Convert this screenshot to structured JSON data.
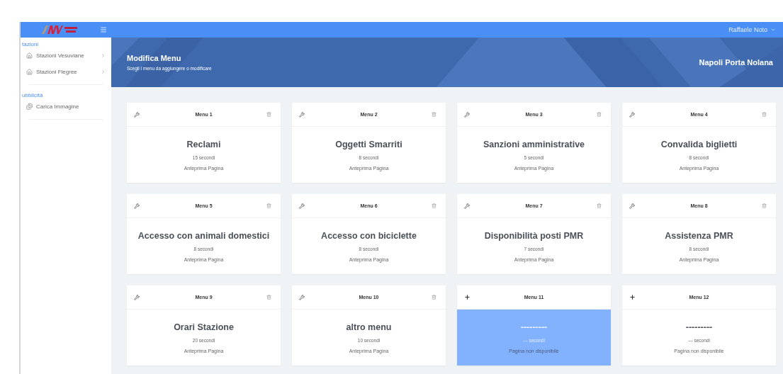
{
  "topbar": {
    "user": "Raffaele Noto"
  },
  "sidebar": {
    "sections": [
      {
        "title": "tazioni",
        "items": [
          {
            "label": "Stazioni Vesuviane",
            "expandable": true
          },
          {
            "label": "Stazioni Flegree",
            "expandable": true
          }
        ]
      },
      {
        "title": "ubblicità",
        "items": [
          {
            "label": "Carica Immagine",
            "expandable": false
          }
        ]
      }
    ]
  },
  "banner": {
    "title": "Modifica Menu",
    "subtitle": "Scegli i menu da aggiungere o modificare",
    "station": "Napoli Porta Nolana"
  },
  "cards": [
    {
      "kind": "configured",
      "header": "Menu 1",
      "title": "Reclami",
      "duration": "15 secondi",
      "link": "Anteprima Pagina",
      "selected": false
    },
    {
      "kind": "configured",
      "header": "Menu 2",
      "title": "Oggetti Smarriti",
      "duration": "8 secondi",
      "link": "Anteprima Pagina",
      "selected": false
    },
    {
      "kind": "configured",
      "header": "Menu 3",
      "title": "Sanzioni amministrative",
      "duration": "5 secondi",
      "link": "Anteprima Pagina",
      "selected": false
    },
    {
      "kind": "configured",
      "header": "Menu 4",
      "title": "Convalida biglietti",
      "duration": "8 secondi",
      "link": "Anteprima Pagina",
      "selected": false
    },
    {
      "kind": "configured",
      "header": "Menu 5",
      "title": "Accesso con animali domestici",
      "duration": "8 secondi",
      "link": "Anteprima Pagina",
      "selected": false
    },
    {
      "kind": "configured",
      "header": "Menu 6",
      "title": "Accesso con biciclette",
      "duration": "8 secondi",
      "link": "Anteprima Pagina",
      "selected": false
    },
    {
      "kind": "configured",
      "header": "Menu 7",
      "title": "Disponibilità posti PMR",
      "duration": "7 secondi",
      "link": "Anteprima Pagina",
      "selected": false
    },
    {
      "kind": "configured",
      "header": "Menu 8",
      "title": "Assistenza PMR",
      "duration": "8 secondi",
      "link": "Anteprima Pagina",
      "selected": false
    },
    {
      "kind": "configured",
      "header": "Menu 9",
      "title": "Orari Stazione",
      "duration": "20 secondi",
      "link": "Anteprima Pagina",
      "selected": false
    },
    {
      "kind": "configured",
      "header": "Menu 10",
      "title": "altro menu",
      "duration": "10 secondi",
      "link": "Anteprima Pagina",
      "selected": false
    },
    {
      "kind": "empty",
      "header": "Menu 11",
      "title": "---------",
      "duration": "--- secondi",
      "link": "Pagina non disponibile",
      "selected": true
    },
    {
      "kind": "empty",
      "header": "Menu 12",
      "title": "---------",
      "duration": "--- secondi",
      "link": "Pagina non disponibile",
      "selected": false
    }
  ]
}
